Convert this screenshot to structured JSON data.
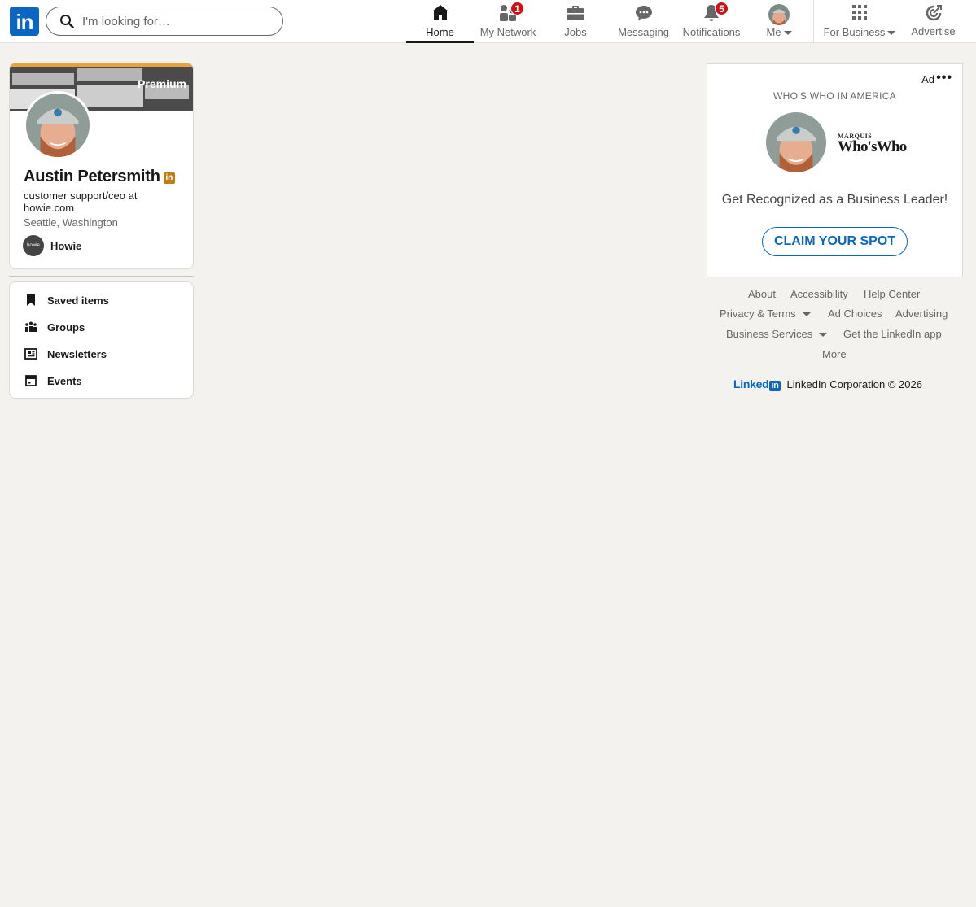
{
  "nav": {
    "logo": "in",
    "search_placeholder": "I'm looking for…",
    "items": [
      {
        "label": "Home",
        "icon": "home-icon",
        "active": true
      },
      {
        "label": "My Network",
        "icon": "network-icon",
        "badge": "1"
      },
      {
        "label": "Jobs",
        "icon": "briefcase-icon"
      },
      {
        "label": "Messaging",
        "icon": "messaging-icon"
      },
      {
        "label": "Notifications",
        "icon": "bell-icon",
        "badge": "5"
      },
      {
        "label": "Me",
        "icon": "avatar"
      },
      {
        "label": "For Business",
        "icon": "grid-icon"
      },
      {
        "label": "Advertise",
        "icon": "advertise-icon"
      }
    ]
  },
  "profile": {
    "premium_label": "Premium",
    "name": "Austin Petersmith",
    "headline": "customer support/ceo at howie.com",
    "location": "Seattle, Washington",
    "company_logo_text": "howie",
    "company": "Howie"
  },
  "links": [
    {
      "label": "Saved items",
      "icon": "bookmark-icon"
    },
    {
      "label": "Groups",
      "icon": "groups-icon"
    },
    {
      "label": "Newsletters",
      "icon": "newsletter-icon"
    },
    {
      "label": "Events",
      "icon": "calendar-icon"
    }
  ],
  "ad": {
    "label": "Ad",
    "sponsor": "WHO'S WHO IN AMERICA",
    "logo_small": "MARQUIS",
    "logo_big": "Who'sWho",
    "headline": "Get Recognized as a Business Leader!",
    "cta": "CLAIM YOUR SPOT"
  },
  "footer": {
    "about": "About",
    "accessibility": "Accessibility",
    "help": "Help Center",
    "privacy": "Privacy & Terms",
    "ad_choices": "Ad Choices",
    "advertising": "Advertising",
    "business_services": "Business Services",
    "get_app": "Get the LinkedIn app",
    "more": "More",
    "brand_word": "Linked",
    "brand_box": "in",
    "copyright": "LinkedIn Corporation © 2026"
  },
  "colors": {
    "brand_blue": "#0a66c2",
    "badge_red": "#cc1016",
    "premium_gold": "#c37d16",
    "background": "#f3f2ef"
  }
}
